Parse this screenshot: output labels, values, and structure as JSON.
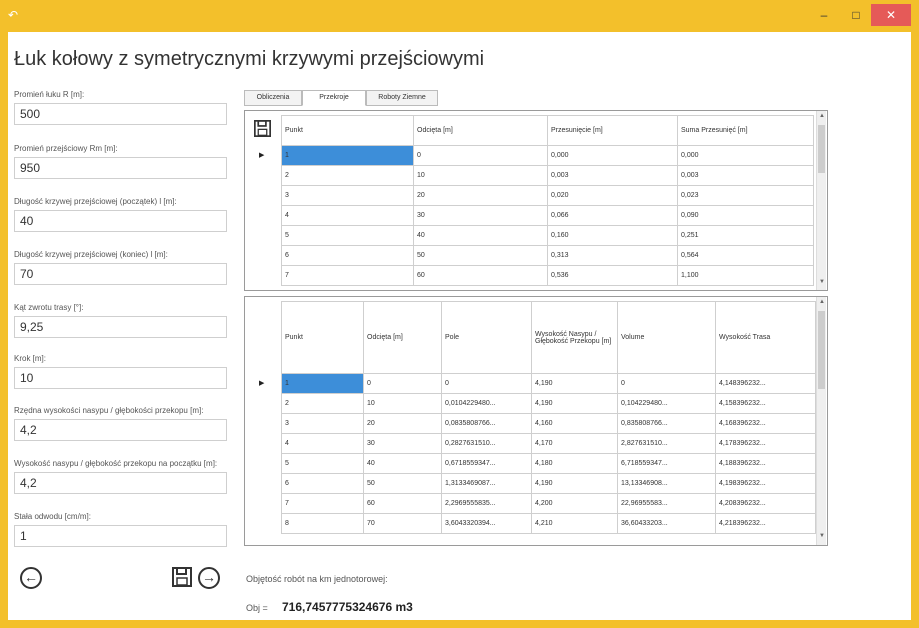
{
  "window": {
    "app_icon": "back-arrow-icon",
    "title": "Łuk kołowy z symetrycznymi krzywymi przejściowymi"
  },
  "form": {
    "fields": [
      {
        "label": "Promień łuku R [m]:",
        "value": "500"
      },
      {
        "label": "Promień przejściowy Rm [m]:",
        "value": "950"
      },
      {
        "label": "Długość krzywej przejściowej (początek) l [m]:",
        "value": "40"
      },
      {
        "label": "Długość krzywej przejściowej (koniec) l [m]:",
        "value": "70"
      },
      {
        "label": "Kąt zwrotu trasy [°]:",
        "value": "9,25"
      },
      {
        "label": "Krok [m]:",
        "value": "10"
      },
      {
        "label": "Rzędna wysokości nasypu / głębokości przekopu [m]:",
        "value": "4,2"
      },
      {
        "label": "Wysokość nasypu / głębokość przekopu na początku [m]:",
        "value": "4,2"
      },
      {
        "label": "Stała odwodu [cm/m]:",
        "value": "1"
      }
    ]
  },
  "tabs": [
    "Obliczenia",
    "Przekroje",
    "Roboty Ziemne"
  ],
  "table1": {
    "columns": [
      "Punkt",
      "Odcięta [m]",
      "Przesunięcie [m]",
      "Suma Przesunięć [m]"
    ],
    "rows": [
      [
        "1",
        "0",
        "0,000",
        "0,000"
      ],
      [
        "2",
        "10",
        "0,003",
        "0,003"
      ],
      [
        "3",
        "20",
        "0,020",
        "0,023"
      ],
      [
        "4",
        "30",
        "0,066",
        "0,090"
      ],
      [
        "5",
        "40",
        "0,160",
        "0,251"
      ],
      [
        "6",
        "50",
        "0,313",
        "0,564"
      ],
      [
        "7",
        "60",
        "0,536",
        "1,100"
      ]
    ]
  },
  "table2": {
    "columns": [
      "Punkt",
      "Odcięta [m]",
      "Pole",
      "Wysokość Nasypu / Głębokość Przekopu [m]",
      "Volume",
      "Wysokość Trasa"
    ],
    "rows": [
      [
        "1",
        "0",
        "0",
        "4,190",
        "0",
        "4,148396232..."
      ],
      [
        "2",
        "10",
        "0,0104229480...",
        "4,190",
        "0,104229480...",
        "4,158396232..."
      ],
      [
        "3",
        "20",
        "0,0835808766...",
        "4,160",
        "0,835808766...",
        "4,168396232..."
      ],
      [
        "4",
        "30",
        "0,2827631510...",
        "4,170",
        "2,827631510...",
        "4,178396232..."
      ],
      [
        "5",
        "40",
        "0,6718559347...",
        "4,180",
        "6,718559347...",
        "4,188396232..."
      ],
      [
        "6",
        "50",
        "1,3133469087...",
        "4,190",
        "13,13346908...",
        "4,198396232..."
      ],
      [
        "7",
        "60",
        "2,2969555835...",
        "4,200",
        "22,96955583...",
        "4,208396232..."
      ],
      [
        "8",
        "70",
        "3,6043320394...",
        "4,210",
        "36,60433203...",
        "4,218396232..."
      ]
    ]
  },
  "volume": {
    "caption": "Objętość robót na km jednotorowej:",
    "label": "Obj =",
    "value": "716,7457775324676 m3"
  }
}
